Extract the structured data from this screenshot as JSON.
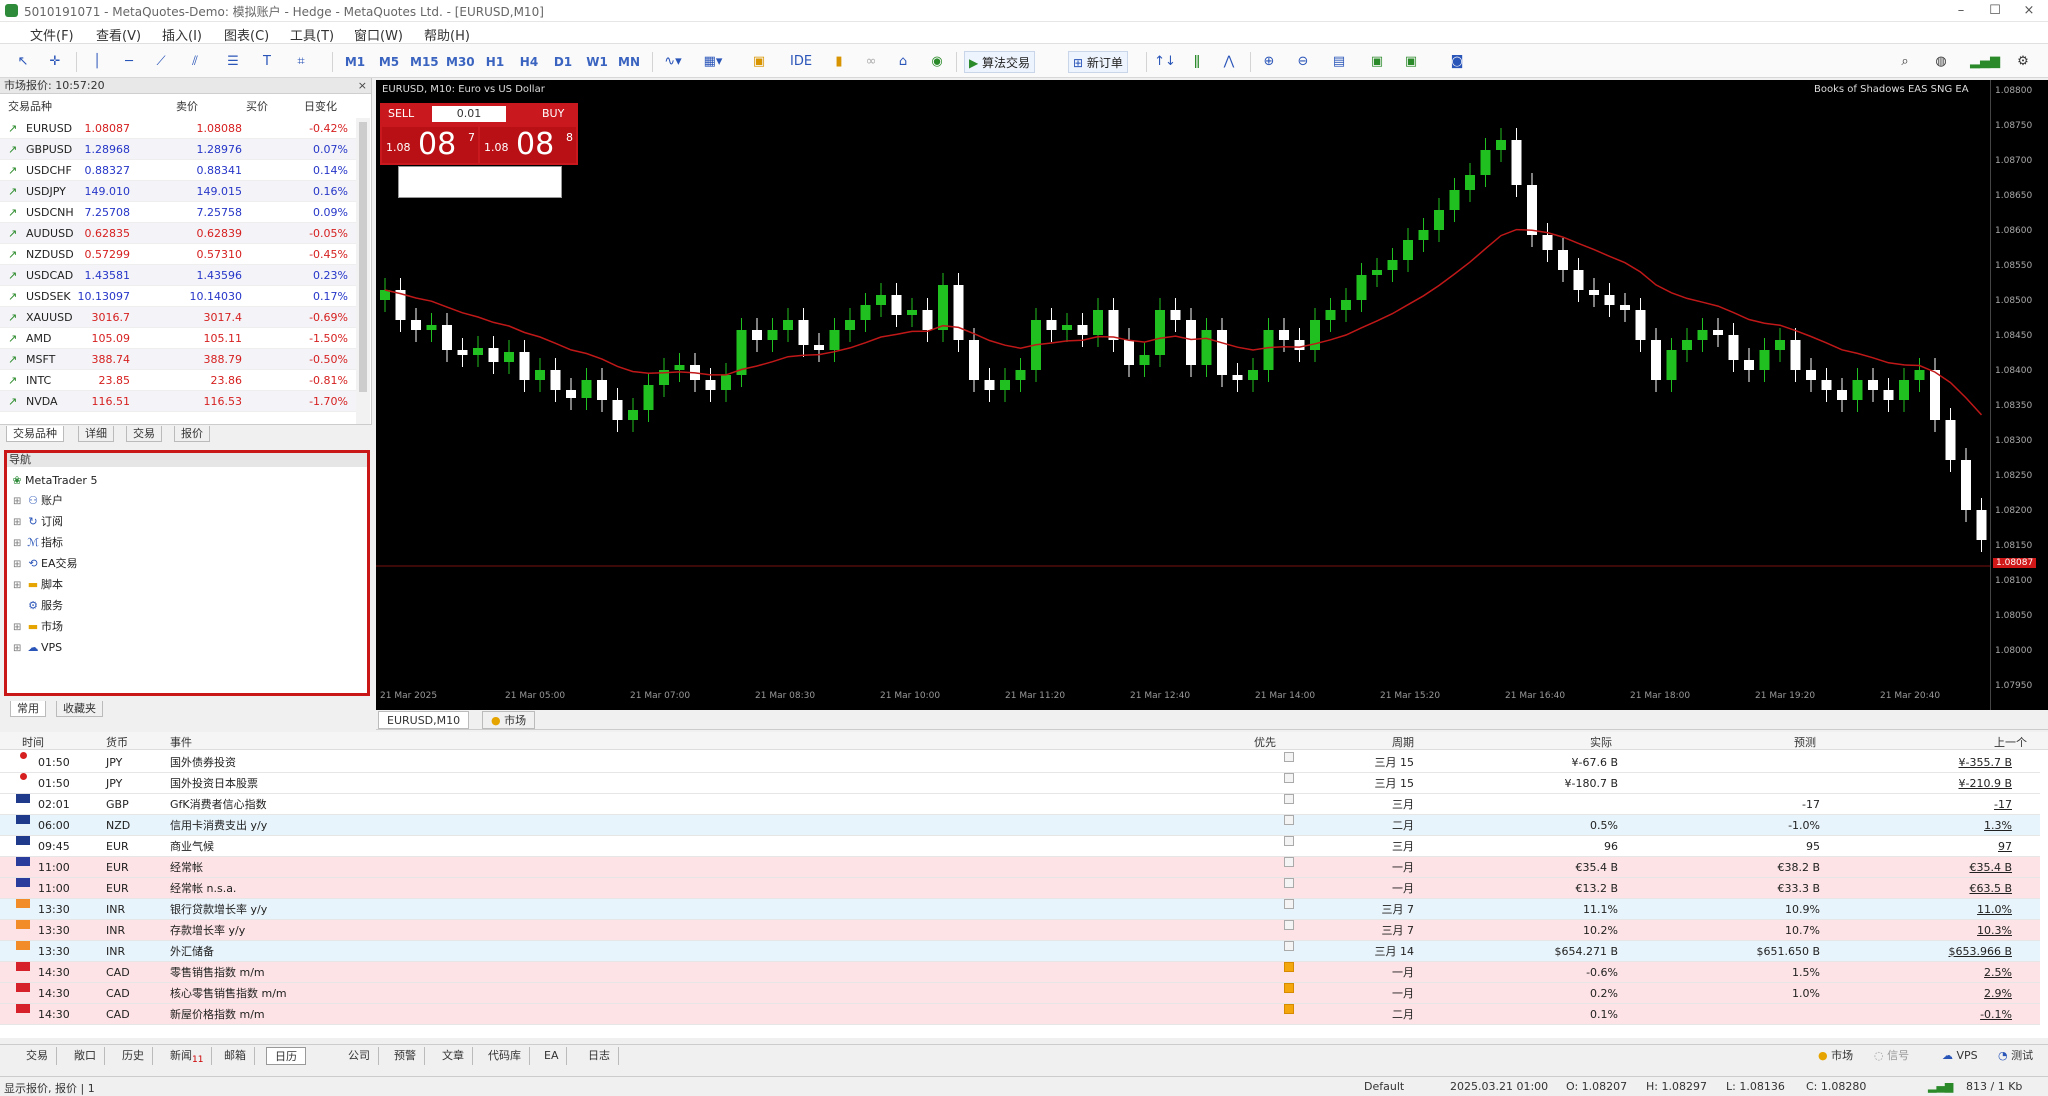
{
  "window": {
    "title": "5010191071 - MetaQuotes-Demo: 模拟账户 - Hedge - MetaQuotes Ltd. - [EURUSD,M10]",
    "controls": [
      "–",
      "☐",
      "×"
    ]
  },
  "menu": [
    "文件(F)",
    "查看(V)",
    "插入(I)",
    "图表(C)",
    "工具(T)",
    "窗口(W)",
    "帮助(H)"
  ],
  "toolbar": {
    "timeframes": [
      "M1",
      "M5",
      "M15",
      "M30",
      "H1",
      "H4",
      "D1",
      "W1",
      "MN"
    ],
    "algo_trading": "算法交易",
    "new_order": "新订单"
  },
  "market_watch": {
    "title": "市场报价: 10:57:20",
    "columns": {
      "symbol": "交易品种",
      "bid": "卖价",
      "ask": "买价",
      "change": "日变化"
    },
    "rows": [
      {
        "symbol": "EURUSD",
        "bid": "1.08087",
        "ask": "1.08088",
        "change": "-0.42%",
        "neg": true
      },
      {
        "symbol": "GBPUSD",
        "bid": "1.28968",
        "ask": "1.28976",
        "change": "0.07%",
        "neg": false
      },
      {
        "symbol": "USDCHF",
        "bid": "0.88327",
        "ask": "0.88341",
        "change": "0.14%",
        "neg": false
      },
      {
        "symbol": "USDJPY",
        "bid": "149.010",
        "ask": "149.015",
        "change": "0.16%",
        "neg": false
      },
      {
        "symbol": "USDCNH",
        "bid": "7.25708",
        "ask": "7.25758",
        "change": "0.09%",
        "neg": false
      },
      {
        "symbol": "AUDUSD",
        "bid": "0.62835",
        "ask": "0.62839",
        "change": "-0.05%",
        "neg": true
      },
      {
        "symbol": "NZDUSD",
        "bid": "0.57299",
        "ask": "0.57310",
        "change": "-0.45%",
        "neg": true
      },
      {
        "symbol": "USDCAD",
        "bid": "1.43581",
        "ask": "1.43596",
        "change": "0.23%",
        "neg": false
      },
      {
        "symbol": "USDSEK",
        "bid": "10.13097",
        "ask": "10.14030",
        "change": "0.17%",
        "neg": false
      },
      {
        "symbol": "XAUUSD",
        "bid": "3016.7",
        "ask": "3017.4",
        "change": "-0.69%",
        "neg": true
      },
      {
        "symbol": "AMD",
        "bid": "105.09",
        "ask": "105.11",
        "change": "-1.50%",
        "neg": true
      },
      {
        "symbol": "MSFT",
        "bid": "388.74",
        "ask": "388.79",
        "change": "-0.50%",
        "neg": true
      },
      {
        "symbol": "INTC",
        "bid": "23.85",
        "ask": "23.86",
        "change": "-0.81%",
        "neg": true
      },
      {
        "symbol": "NVDA",
        "bid": "116.51",
        "ask": "116.53",
        "change": "-1.70%",
        "neg": true
      }
    ],
    "tabs": [
      "交易品种",
      "详细",
      "交易",
      "报价"
    ]
  },
  "navigator": {
    "title": "导航",
    "root": "MetaTrader 5",
    "items": [
      "账户",
      "订阅",
      "指标",
      "EA交易",
      "脚本",
      "服务",
      "市场",
      "VPS"
    ],
    "tabs": [
      "常用",
      "收藏夹"
    ]
  },
  "chart": {
    "symbol_line": "EURUSD, M10: Euro vs US Dollar",
    "signal": "Books of Shadows EAS SNG EA",
    "one_click": {
      "sell": "SELL",
      "buy": "BUY",
      "lot": "0.01",
      "bid_small": "1.08",
      "bid_big": "08",
      "bid_sup": "7",
      "ask_small": "1.08",
      "ask_big": "08",
      "ask_sup": "8"
    },
    "current_price": "1.08087",
    "price_ticks": [
      "1.08800",
      "1.08750",
      "1.08700",
      "1.08650",
      "1.08600",
      "1.08550",
      "1.08500",
      "1.08450",
      "1.08400",
      "1.08350",
      "1.08300",
      "1.08250",
      "1.08200",
      "1.08150",
      "1.08100",
      "1.08050",
      "1.08000",
      "1.07950"
    ],
    "time_labels": [
      "21 Mar 2025",
      "21 Mar 05:00",
      "21 Mar 07:00",
      "21 Mar 08:30",
      "21 Mar 10:00",
      "21 Mar 11:20",
      "21 Mar 12:40",
      "21 Mar 14:00",
      "21 Mar 15:20",
      "21 Mar 16:40",
      "21 Mar 18:00",
      "21 Mar 19:20",
      "21 Mar 20:40"
    ]
  },
  "chart_tabs": [
    "EURUSD,M10",
    "市场"
  ],
  "calendar": {
    "columns": [
      "时间",
      "货币",
      "事件",
      "优先",
      "周期",
      "实际",
      "预测",
      "上一个"
    ],
    "rows": [
      {
        "flag": "dot",
        "time": "01:50",
        "cur": "JPY",
        "event": "国外债券投资",
        "prio": false,
        "period": "三月 15",
        "actual": "¥-67.6 B",
        "forecast": "",
        "prev": "¥-355.7 B",
        "cls": ""
      },
      {
        "flag": "dot",
        "time": "01:50",
        "cur": "JPY",
        "event": "国外投资日本股票",
        "prio": false,
        "period": "三月 15",
        "actual": "¥-180.7 B",
        "forecast": "",
        "prev": "¥-210.9 B",
        "cls": ""
      },
      {
        "flag": "gb",
        "time": "02:01",
        "cur": "GBP",
        "event": "GfK消费者信心指数",
        "prio": false,
        "period": "三月",
        "actual": "",
        "forecast": "-17",
        "prev": "-17",
        "cls": ""
      },
      {
        "flag": "nz",
        "time": "06:00",
        "cur": "NZD",
        "event": "信用卡消费支出 y/y",
        "prio": false,
        "period": "二月",
        "actual": "0.5%",
        "forecast": "-1.0%",
        "prev": "1.3%",
        "cls": "mid"
      },
      {
        "flag": "fr",
        "time": "09:45",
        "cur": "EUR",
        "event": "商业气候",
        "prio": false,
        "period": "三月",
        "actual": "96",
        "forecast": "95",
        "prev": "97",
        "cls": ""
      },
      {
        "flag": "eu",
        "time": "11:00",
        "cur": "EUR",
        "event": "经常帐",
        "prio": false,
        "period": "一月",
        "actual": "€35.4 B",
        "forecast": "€38.2 B",
        "prev": "€35.4 B",
        "cls": "hi"
      },
      {
        "flag": "eu",
        "time": "11:00",
        "cur": "EUR",
        "event": "经常帐 n.s.a.",
        "prio": false,
        "period": "一月",
        "actual": "€13.2 B",
        "forecast": "€33.3 B",
        "prev": "€63.5 B",
        "cls": "hi"
      },
      {
        "flag": "in",
        "time": "13:30",
        "cur": "INR",
        "event": "银行贷款增长率 y/y",
        "prio": false,
        "period": "三月 7",
        "actual": "11.1%",
        "forecast": "10.9%",
        "prev": "11.0%",
        "cls": "mid"
      },
      {
        "flag": "in",
        "time": "13:30",
        "cur": "INR",
        "event": "存款增长率 y/y",
        "prio": false,
        "period": "三月 7",
        "actual": "10.2%",
        "forecast": "10.7%",
        "prev": "10.3%",
        "cls": "hi"
      },
      {
        "flag": "in",
        "time": "13:30",
        "cur": "INR",
        "event": "外汇储备",
        "prio": false,
        "period": "三月 14",
        "actual": "$654.271 B",
        "forecast": "$651.650 B",
        "prev": "$653.966 B",
        "cls": "mid"
      },
      {
        "flag": "ca",
        "time": "14:30",
        "cur": "CAD",
        "event": "零售销售指数 m/m",
        "prio": true,
        "period": "一月",
        "actual": "-0.6%",
        "forecast": "1.5%",
        "prev": "2.5%",
        "cls": "hi"
      },
      {
        "flag": "ca",
        "time": "14:30",
        "cur": "CAD",
        "event": "核心零售销售指数 m/m",
        "prio": true,
        "period": "一月",
        "actual": "0.2%",
        "forecast": "1.0%",
        "prev": "2.9%",
        "cls": "hi"
      },
      {
        "flag": "ca",
        "time": "14:30",
        "cur": "CAD",
        "event": "新屋价格指数 m/m",
        "prio": true,
        "period": "二月",
        "actual": "0.1%",
        "forecast": "",
        "prev": "-0.1%",
        "cls": "hi"
      }
    ]
  },
  "bottom_tabs": [
    "交易",
    "敞口",
    "历史",
    "新闻",
    "邮箱",
    "日历",
    "公司",
    "预警",
    "文章",
    "代码库",
    "EA",
    "日志"
  ],
  "bottom_tabs_badge": "11",
  "statusbar": {
    "left": "显示报价, 报价 | 1",
    "profile": "Default",
    "datetime": "2025.03.21 01:00",
    "o": "O: 1.08207",
    "h": "H: 1.08297",
    "l": "L: 1.08136",
    "c": "C: 1.08280",
    "market": "市场",
    "signals": "信号",
    "vps": "VPS",
    "tester": "测试",
    "traffic": "813 / 1 Kb"
  }
}
